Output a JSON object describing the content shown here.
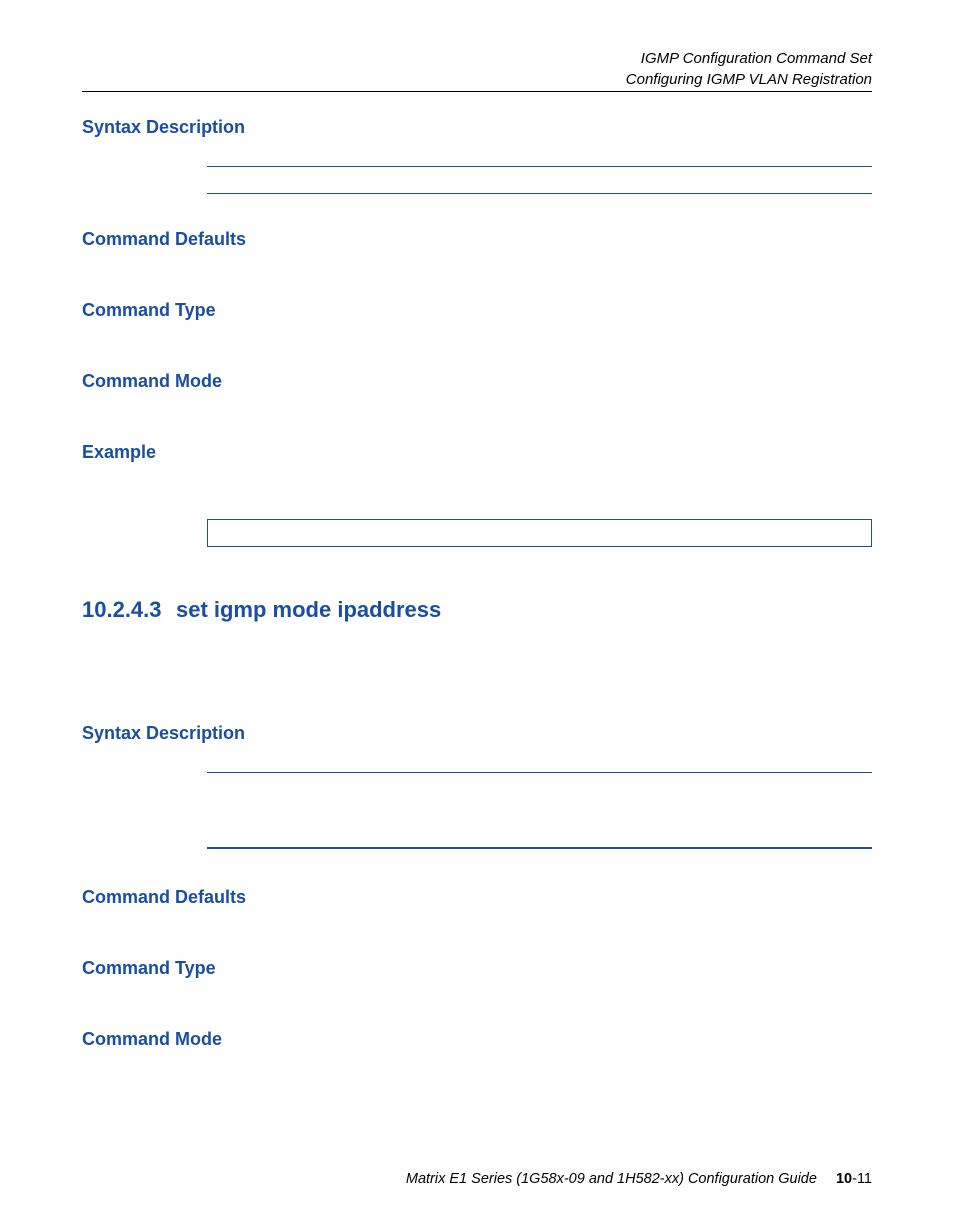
{
  "header": {
    "line1": "IGMP Configuration Command Set",
    "line2": "Configuring IGMP VLAN Registration"
  },
  "sections1": {
    "syntax_description": "Syntax Description",
    "command_defaults": "Command Defaults",
    "command_type": "Command Type",
    "command_mode": "Command Mode",
    "example": "Example"
  },
  "command": {
    "number": "10.2.4.3",
    "title": "set igmp mode ipaddress"
  },
  "sections2": {
    "syntax_description": "Syntax Description",
    "command_defaults": "Command Defaults",
    "command_type": "Command Type",
    "command_mode": "Command Mode"
  },
  "footer": {
    "guide_name": "Matrix E1 Series (1G58x-09 and 1H582-xx) Configuration Guide",
    "page_chapter": "10",
    "page_num": "-11"
  }
}
